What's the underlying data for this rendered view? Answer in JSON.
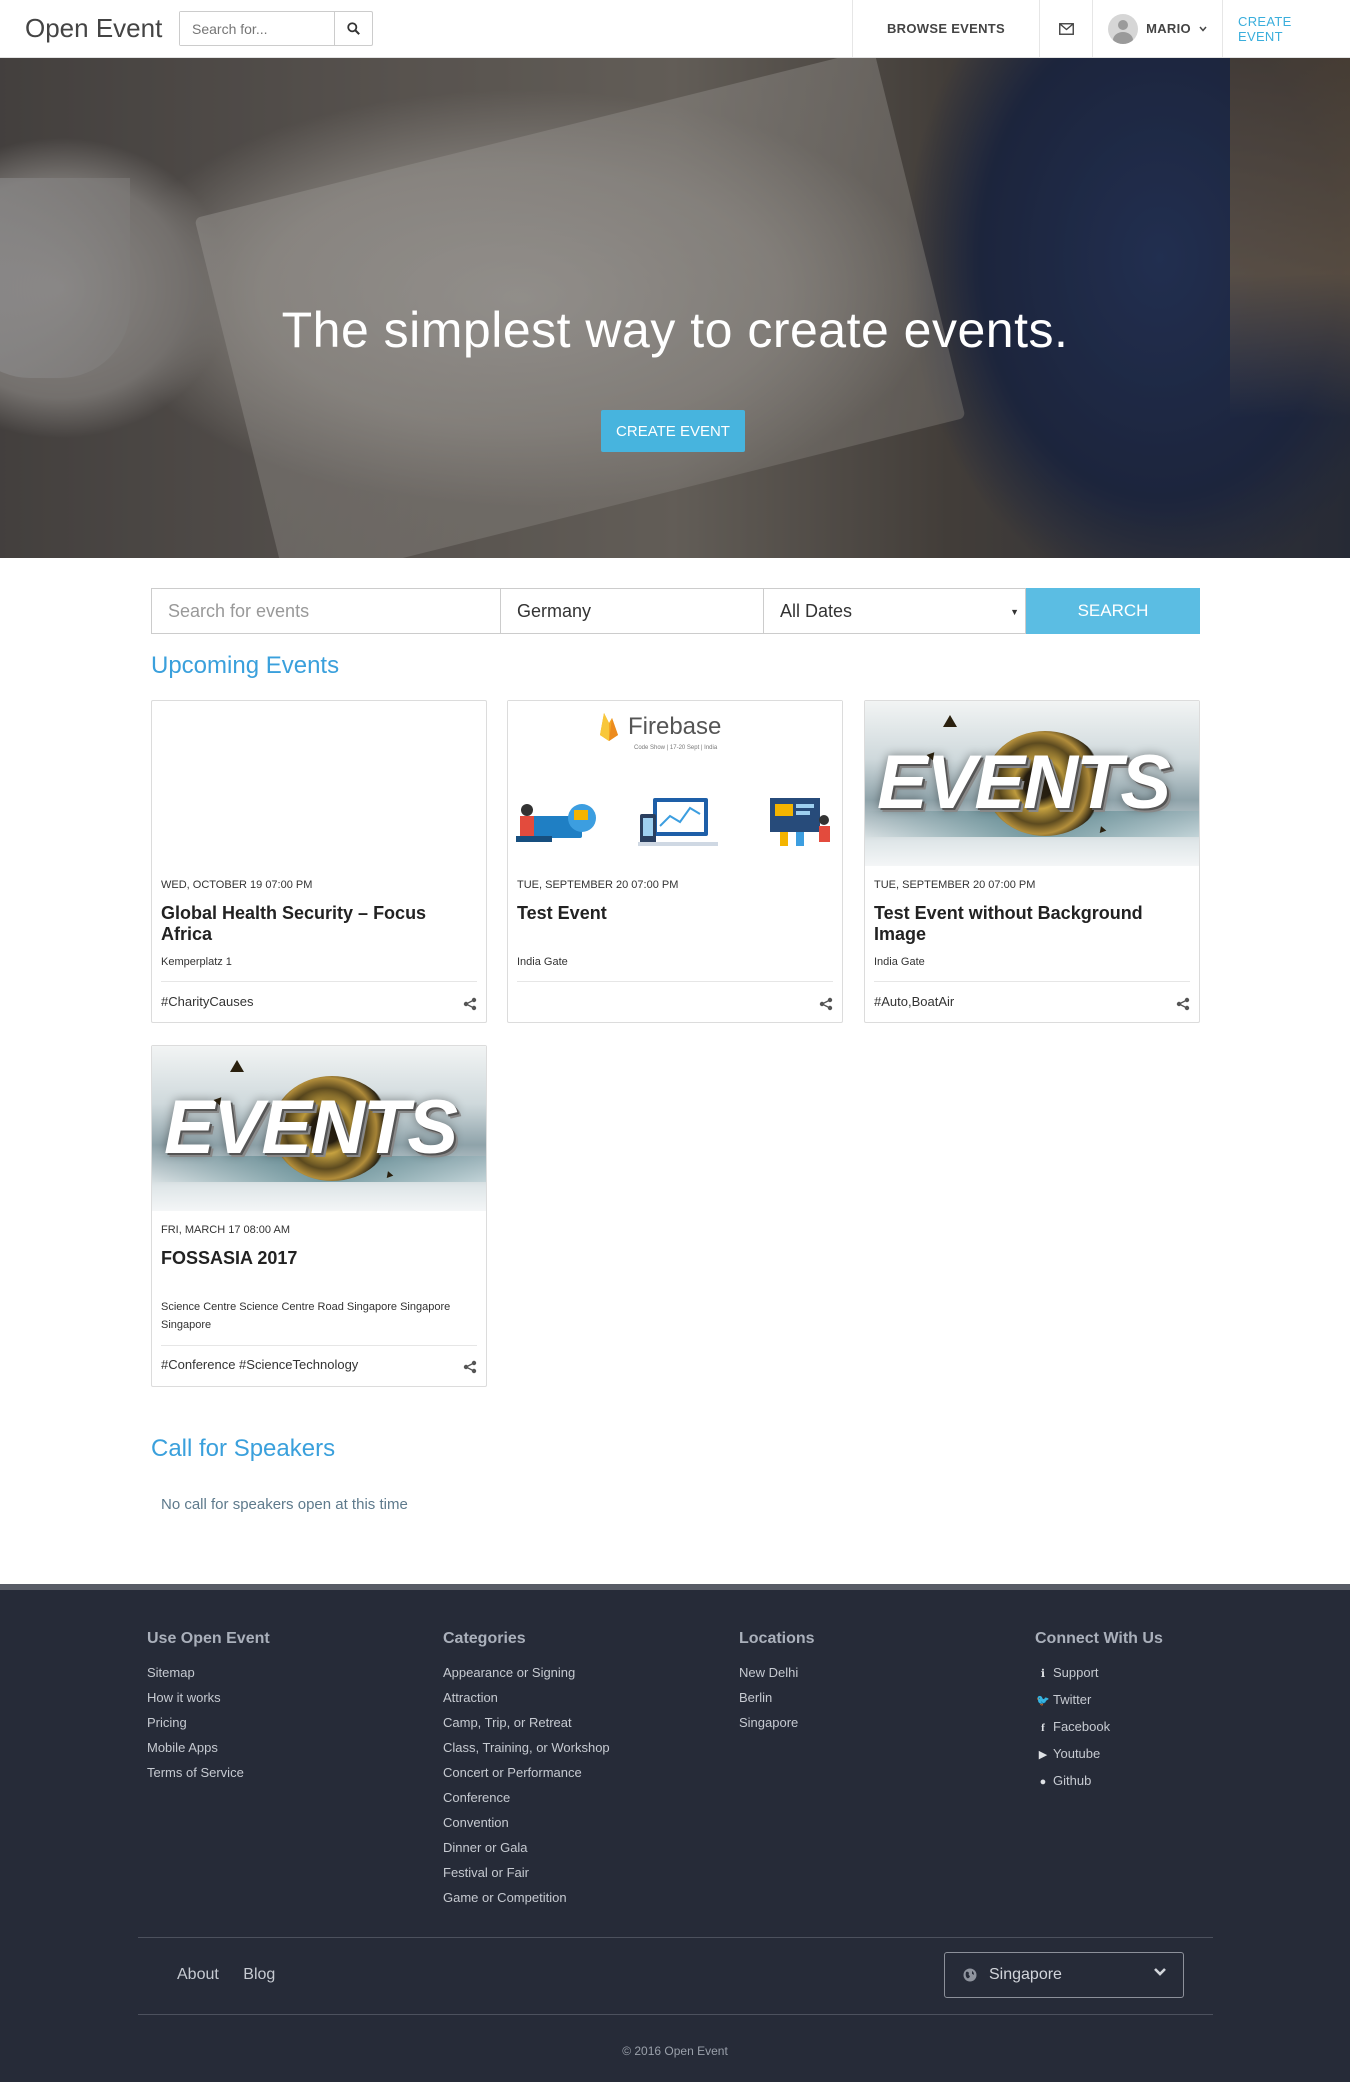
{
  "nav": {
    "brand": "Open Event",
    "search_placeholder": "Search for...",
    "browse": "BROWSE EVENTS",
    "user": "MARIO",
    "create": "CREATE EVENT"
  },
  "hero": {
    "headline": "The simplest way to create events.",
    "button": "CREATE EVENT"
  },
  "search": {
    "placeholder": "Search for events",
    "location": "Germany",
    "dates": "All Dates",
    "button": "SEARCH"
  },
  "upcoming": {
    "title": "Upcoming Events",
    "cards": [
      {
        "date": "WED, OCTOBER 19 07:00 PM",
        "title": "Global Health Security – Focus Africa",
        "location": "Kemperplatz 1",
        "tags": "#CharityCauses"
      },
      {
        "date": "TUE, SEPTEMBER 20 07:00 PM",
        "title": "Test Event",
        "location": "India Gate",
        "tags": "",
        "banner": "Firebase",
        "banner_sub": "Code Show | 17-20 Sept | India"
      },
      {
        "date": "TUE, SEPTEMBER 20 07:00 PM",
        "title": "Test Event without Background Image",
        "location": "India Gate",
        "tags": "#Auto,BoatAir",
        "banner": "EVENTS"
      },
      {
        "date": "FRI, MARCH 17 08:00 AM",
        "title": "FOSSASIA 2017",
        "location": "Science Centre Science Centre Road Singapore Singapore Singapore",
        "tags": "#Conference #ScienceTechnology",
        "banner": "EVENTS"
      }
    ]
  },
  "speakers": {
    "title": "Call for Speakers",
    "message": "No call for speakers open at this time"
  },
  "footer": {
    "use": {
      "title": "Use Open Event",
      "links": [
        "Sitemap",
        "How it works",
        "Pricing",
        "Mobile Apps",
        "Terms of Service"
      ]
    },
    "categories": {
      "title": "Categories",
      "links": [
        "Appearance or Signing",
        "Attraction",
        "Camp, Trip, or Retreat",
        "Class, Training, or Workshop",
        "Concert or Performance",
        "Conference",
        "Convention",
        "Dinner or Gala",
        "Festival or Fair",
        "Game or Competition"
      ]
    },
    "locations": {
      "title": "Locations",
      "links": [
        "New Delhi",
        "Berlin",
        "Singapore"
      ]
    },
    "connect": {
      "title": "Connect With Us",
      "links": [
        "Support",
        "Twitter",
        "Facebook",
        "Youtube",
        "Github"
      ]
    },
    "about": "About",
    "blog": "Blog",
    "language": "Singapore",
    "copyright": "© 2016 Open Event"
  },
  "colors": {
    "accent": "#3aaedc",
    "button": "#47b4de",
    "footer_bg": "#262b38"
  }
}
